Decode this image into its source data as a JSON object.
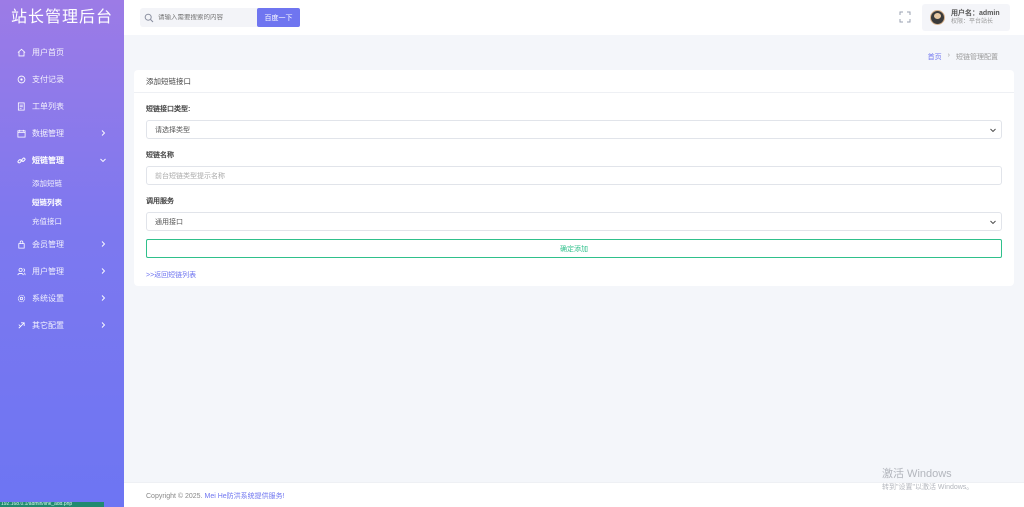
{
  "sidebar": {
    "brand": "站长管理后台",
    "items": [
      {
        "label": "用户首页",
        "icon": "home-icon"
      },
      {
        "label": "支付记录",
        "icon": "payment-icon"
      },
      {
        "label": "工单列表",
        "icon": "ticket-icon"
      },
      {
        "label": "数据管理",
        "icon": "calendar-icon"
      },
      {
        "label": "短链管理",
        "icon": "link-icon",
        "expanded": true,
        "children": [
          {
            "label": "添加短链"
          },
          {
            "label": "短链列表"
          },
          {
            "label": "充值接口"
          }
        ]
      },
      {
        "label": "会员管理",
        "icon": "member-icon"
      },
      {
        "label": "用户管理",
        "icon": "users-icon"
      },
      {
        "label": "系统设置",
        "icon": "settings-icon"
      },
      {
        "label": "其它配置",
        "icon": "config-icon"
      }
    ]
  },
  "topbar": {
    "search_placeholder": "请输入需要搜索的内容",
    "search_button": "百度一下",
    "user_name": "用户名：admin",
    "user_role": "权限：平台站长"
  },
  "breadcrumb": {
    "home": "首页",
    "separator": "›",
    "current": "短链管理配置"
  },
  "card": {
    "title": "添加短链接口",
    "fields": {
      "type_label": "短链接口类型:",
      "type_value": "请选择类型",
      "name_label": "短链名称",
      "name_placeholder": "前台短链类型提示名称",
      "service_label": "调用服务",
      "service_value": "通用接口"
    },
    "submit": "确定添加",
    "back_link": ">>返回短链列表"
  },
  "footer": {
    "copyright": "Copyright © 2025.",
    "link": "Mei He防洪系统提供服务!"
  },
  "watermark": {
    "line1": "激活 Windows",
    "line2": "转到\"设置\"以激活 Windows。"
  },
  "status_bar": "192.168.0.1/admin/link_add.php",
  "colors": {
    "accent": "#6f75f0",
    "success": "#2fc08b",
    "sidebar_top": "#9c7be6",
    "sidebar_bottom": "#6d75f3"
  }
}
